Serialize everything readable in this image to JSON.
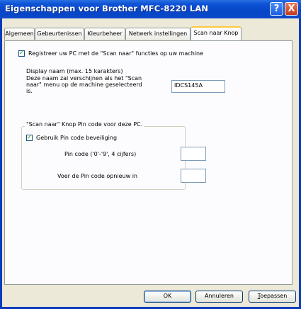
{
  "window": {
    "title": "Eigenschappen voor Brother MFC-8220 LAN",
    "help_glyph": "?",
    "close_glyph": "X"
  },
  "tabs": [
    {
      "label": "Algemeen"
    },
    {
      "label": "Gebeurtenissen"
    },
    {
      "label": "Kleurbeheer"
    },
    {
      "label": "Netwerk instellingen"
    },
    {
      "label": "Scan naar Knop",
      "active": true
    }
  ],
  "register": {
    "checked": true,
    "label": "Registreer uw PC met de \"Scan naar\" functies op uw machine"
  },
  "display_name": {
    "line1": "Display naam (max. 15 karakters)",
    "line2": "Deze naam zal verschijnen als het \"Scan",
    "line3": "naar\" menu op de machine geselecteerd",
    "line4": "is.",
    "value": "IDCS145A"
  },
  "pin_group": {
    "title": "\"Scan naar\" Knop Pin code voor deze PC.",
    "use_pin_checked": true,
    "use_pin_label": "Gebruik Pin code beveiliging",
    "pin_label": "Pin code ('0'-'9', 4 cijfers)",
    "pin_value": "",
    "confirm_label": "Voer de Pin code opnieuw in",
    "confirm_value": ""
  },
  "buttons": {
    "ok": "OK",
    "cancel": "Annuleren",
    "apply_first": "T",
    "apply_rest": "oepassen"
  },
  "check_glyph": "✓"
}
